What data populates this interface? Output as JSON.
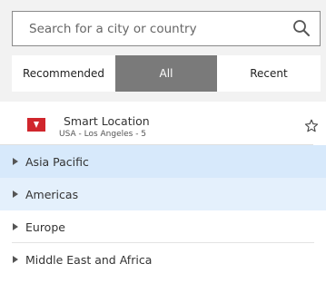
{
  "search": {
    "placeholder": "Search for a city or country",
    "value": ""
  },
  "tabs": [
    {
      "label": "Recommended",
      "selected": false
    },
    {
      "label": "All",
      "selected": true
    },
    {
      "label": "Recent",
      "selected": false
    }
  ],
  "smart_location": {
    "title": "Smart Location",
    "subtitle": "USA - Los Angeles - 5",
    "flag_color": "#d0262c"
  },
  "regions": [
    {
      "label": "Asia Pacific"
    },
    {
      "label": "Americas"
    },
    {
      "label": "Europe"
    },
    {
      "label": "Middle East and Africa"
    }
  ],
  "colors": {
    "selected_tab": "#7a7a7a",
    "hover_row": "#d7e9fb",
    "highlight_row": "#e4f0fc"
  }
}
